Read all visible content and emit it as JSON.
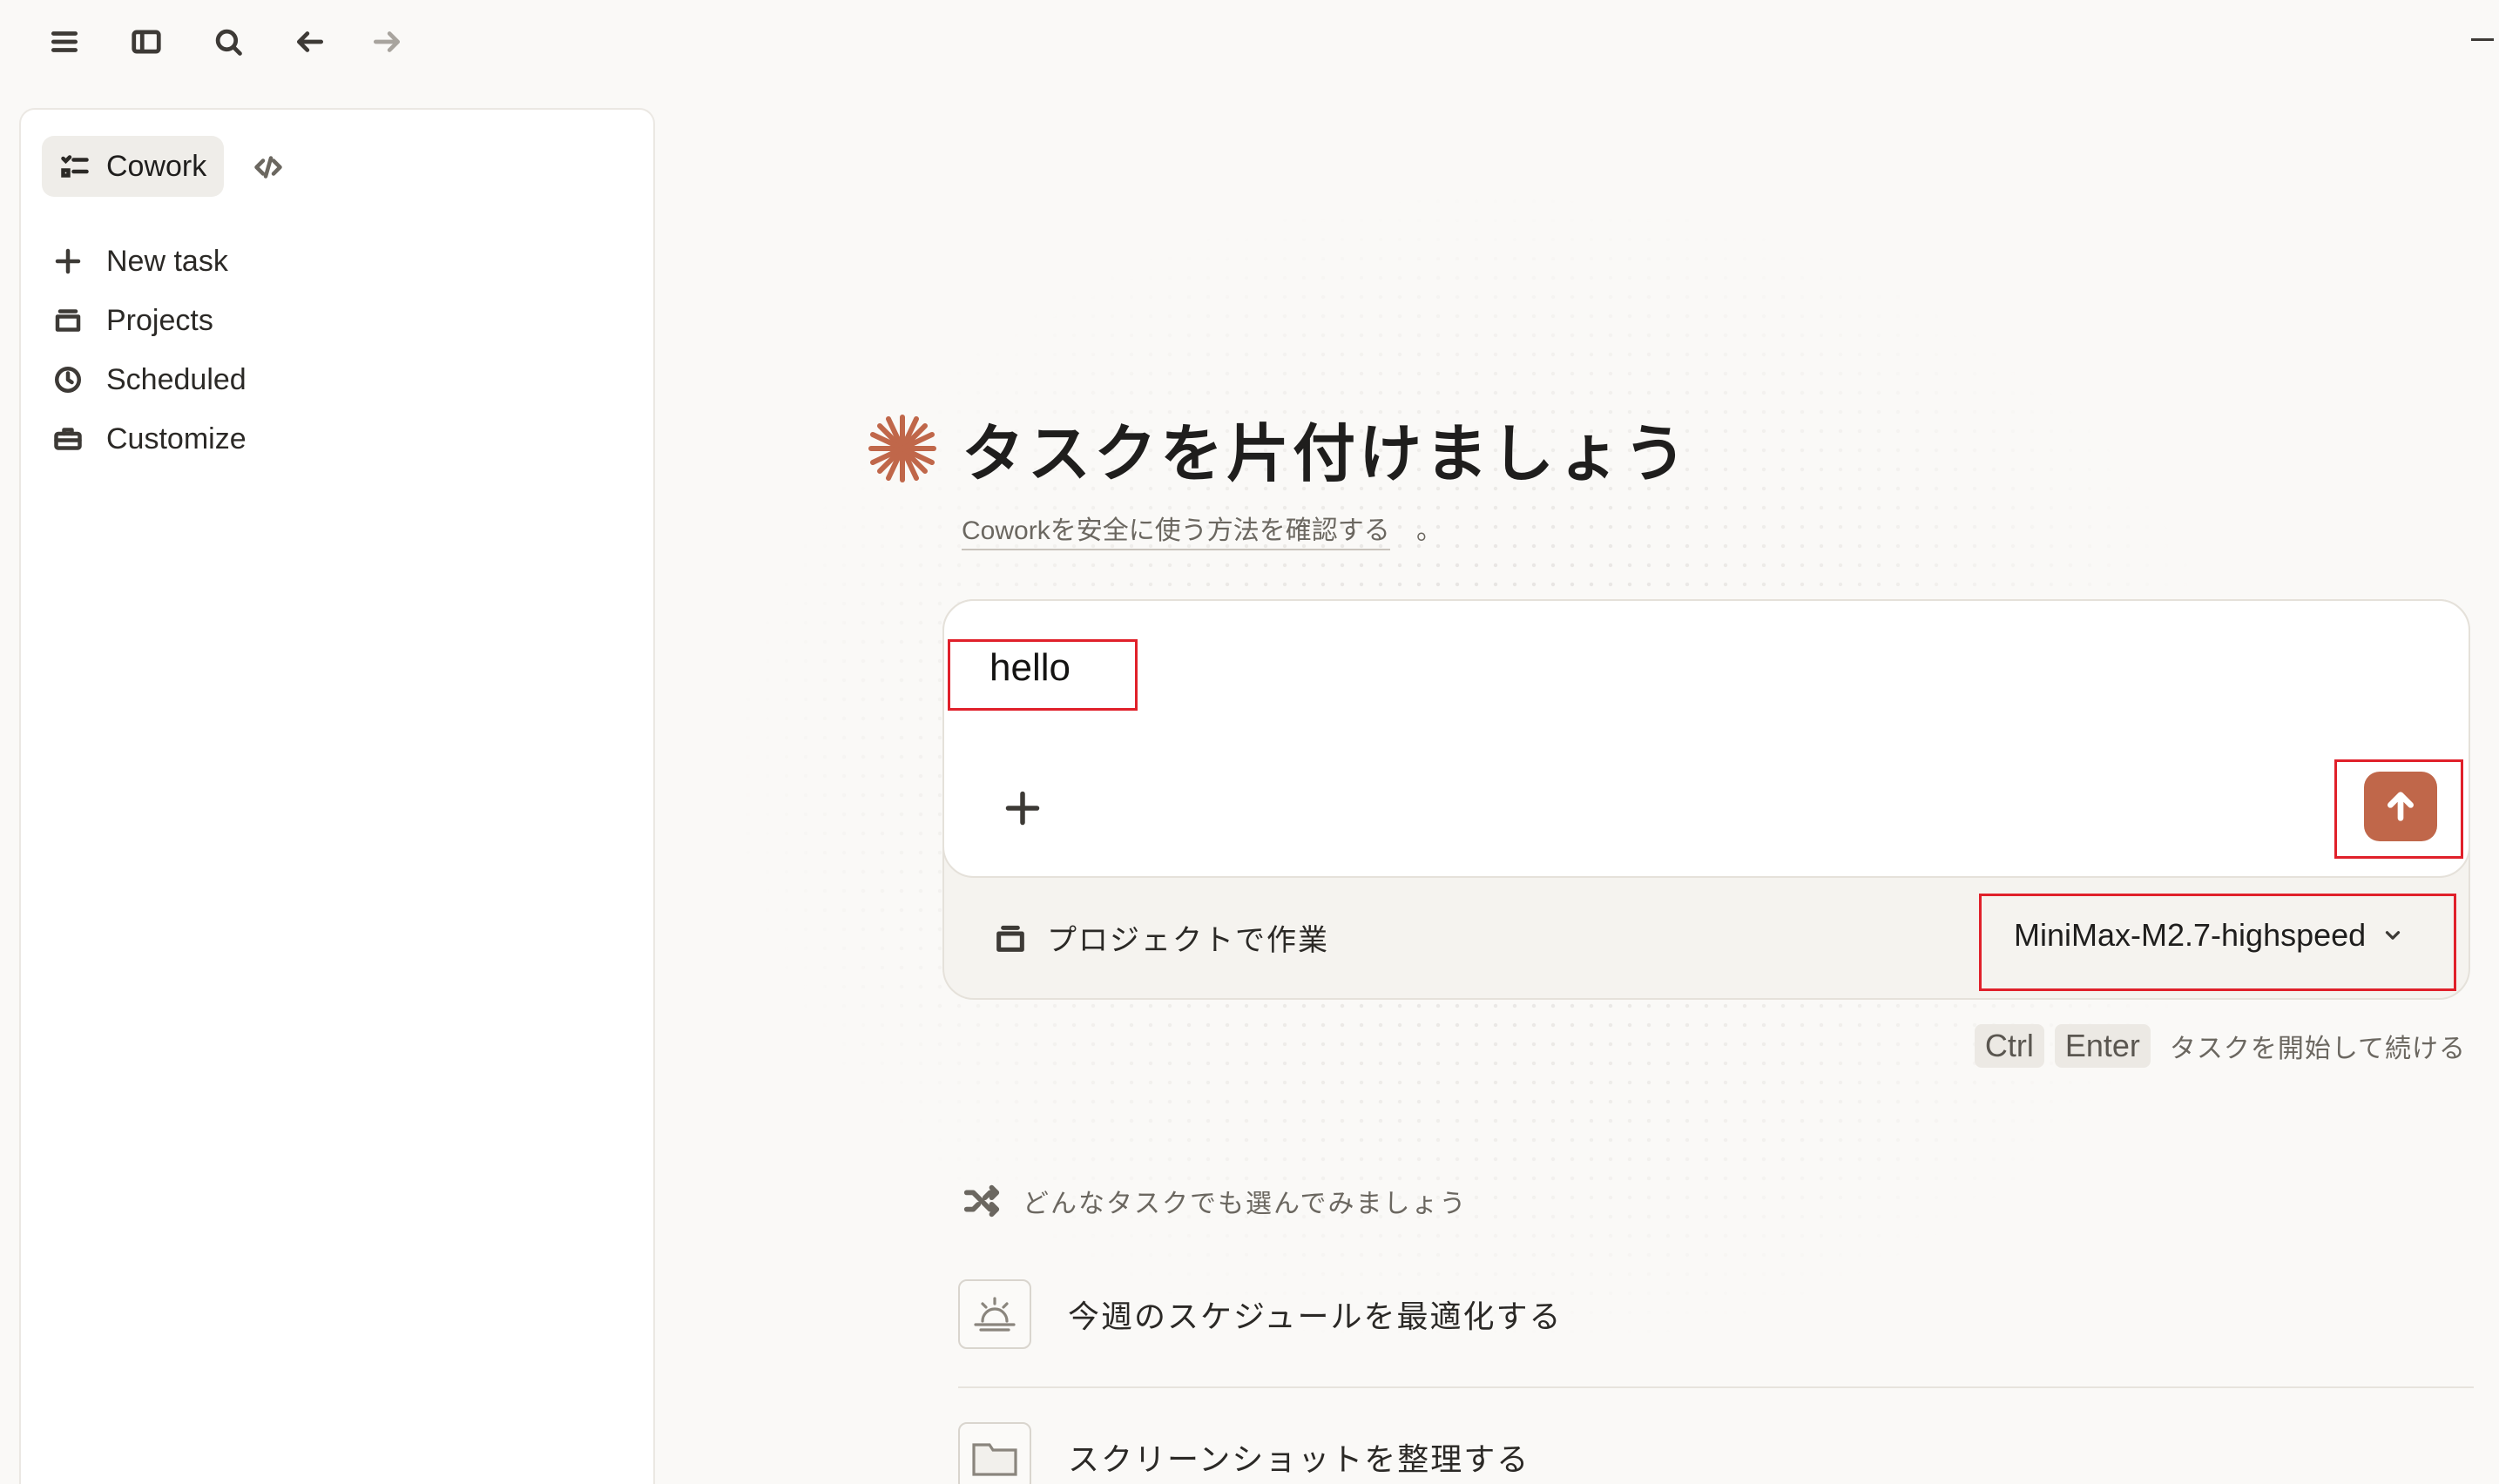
{
  "topbar": {
    "icons": [
      "menu-icon",
      "sidebar-toggle-icon",
      "search-icon",
      "back-arrow-icon",
      "forward-arrow-icon",
      "minimize-icon"
    ]
  },
  "sidebar": {
    "mode_tab": {
      "label": "Cowork",
      "icon": "checklist-icon"
    },
    "code_tab_icon": "code-icon",
    "nav": [
      {
        "label": "New task",
        "icon": "plus-icon"
      },
      {
        "label": "Projects",
        "icon": "folder-stack-icon"
      },
      {
        "label": "Scheduled",
        "icon": "clock-icon"
      },
      {
        "label": "Customize",
        "icon": "briefcase-icon"
      }
    ]
  },
  "main": {
    "title": "タスクを片付けましょう",
    "safety_link": "Coworkを安全に使う方法を確認する",
    "safety_suffix": "。",
    "composer": {
      "input_value": "hello",
      "send_icon": "arrow-up-icon",
      "attach_icon": "plus-icon",
      "project_label": "プロジェクトで作業",
      "model": "MiniMax-M2.7-highspeed"
    },
    "shortcut": {
      "keys": [
        "Ctrl",
        "Enter"
      ],
      "hint": "タスクを開始して続ける"
    },
    "suggestions_header": "どんなタスクでも選んでみましょう",
    "suggestions": [
      {
        "label": "今週のスケジュールを最適化する",
        "icon": "sunrise-icon"
      },
      {
        "label": "スクリーンショットを整理する",
        "icon": "folder-icon"
      }
    ]
  },
  "colors": {
    "accent": "#c0674a",
    "highlight_box": "#e0202a",
    "background": "#faf9f7"
  }
}
